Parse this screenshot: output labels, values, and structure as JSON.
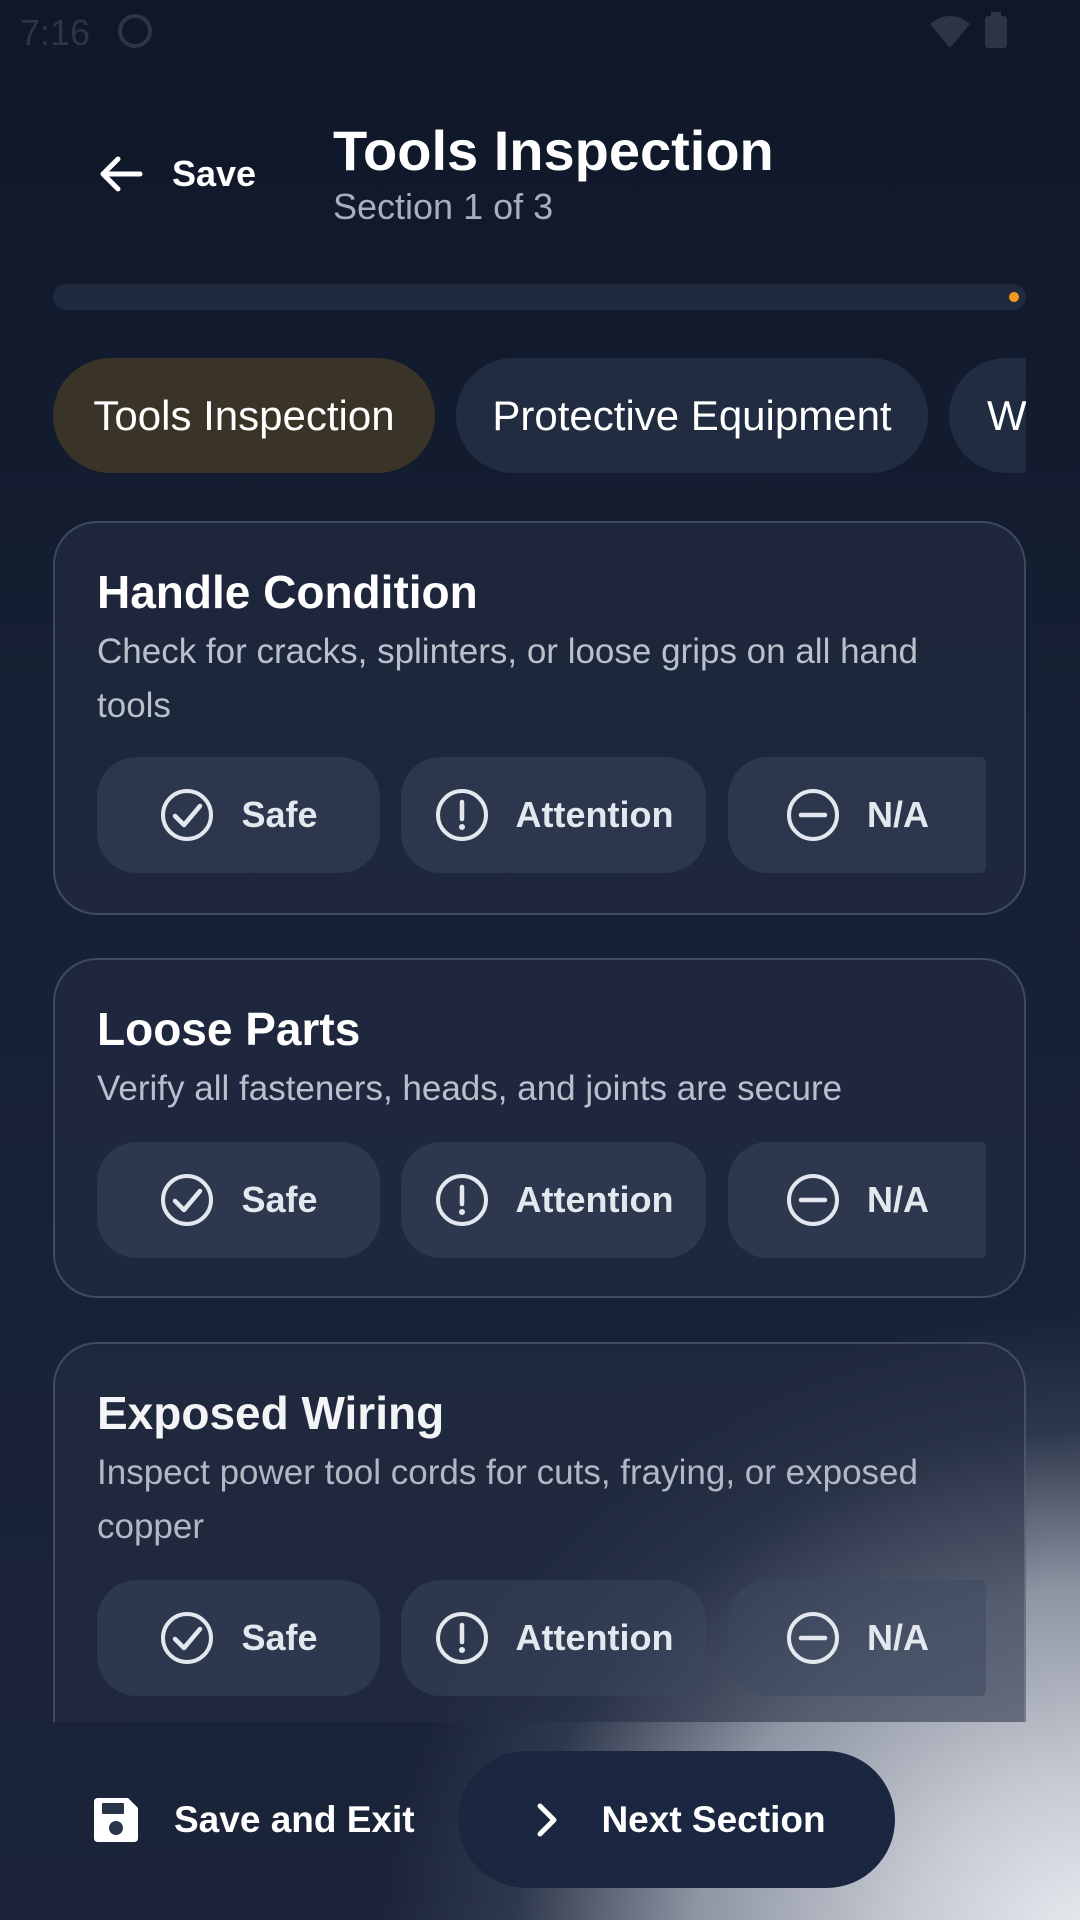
{
  "status_bar": {
    "time": "7:16"
  },
  "header": {
    "back_label": "Save",
    "title": "Tools Inspection",
    "subtitle": "Section 1 of 3"
  },
  "progress": {
    "fraction": 1.0,
    "accent": "#f39a1e"
  },
  "tabs": [
    {
      "label": "Tools Inspection",
      "active": true
    },
    {
      "label": "Protective Equipment",
      "active": false
    },
    {
      "label": "Work",
      "active": false
    }
  ],
  "items": [
    {
      "title": "Handle Condition",
      "description": "Check for cracks, splinters, or loose grips on all hand tools",
      "options": [
        "Safe",
        "Attention",
        "N/A"
      ]
    },
    {
      "title": "Loose Parts",
      "description": "Verify all fasteners, heads, and joints are secure",
      "options": [
        "Safe",
        "Attention",
        "N/A"
      ]
    },
    {
      "title": "Exposed Wiring",
      "description": "Inspect power tool cords for cuts, fraying, or exposed copper",
      "options": [
        "Safe",
        "Attention",
        "N/A"
      ]
    }
  ],
  "footer": {
    "save_exit_label": "Save and Exit",
    "next_label": "Next Section"
  },
  "icons": {
    "safe": "check-circle-icon",
    "attention": "exclamation-circle-icon",
    "na": "minus-circle-icon",
    "back": "arrow-left-icon",
    "save": "floppy-disk-icon",
    "next": "chevron-right-icon"
  }
}
